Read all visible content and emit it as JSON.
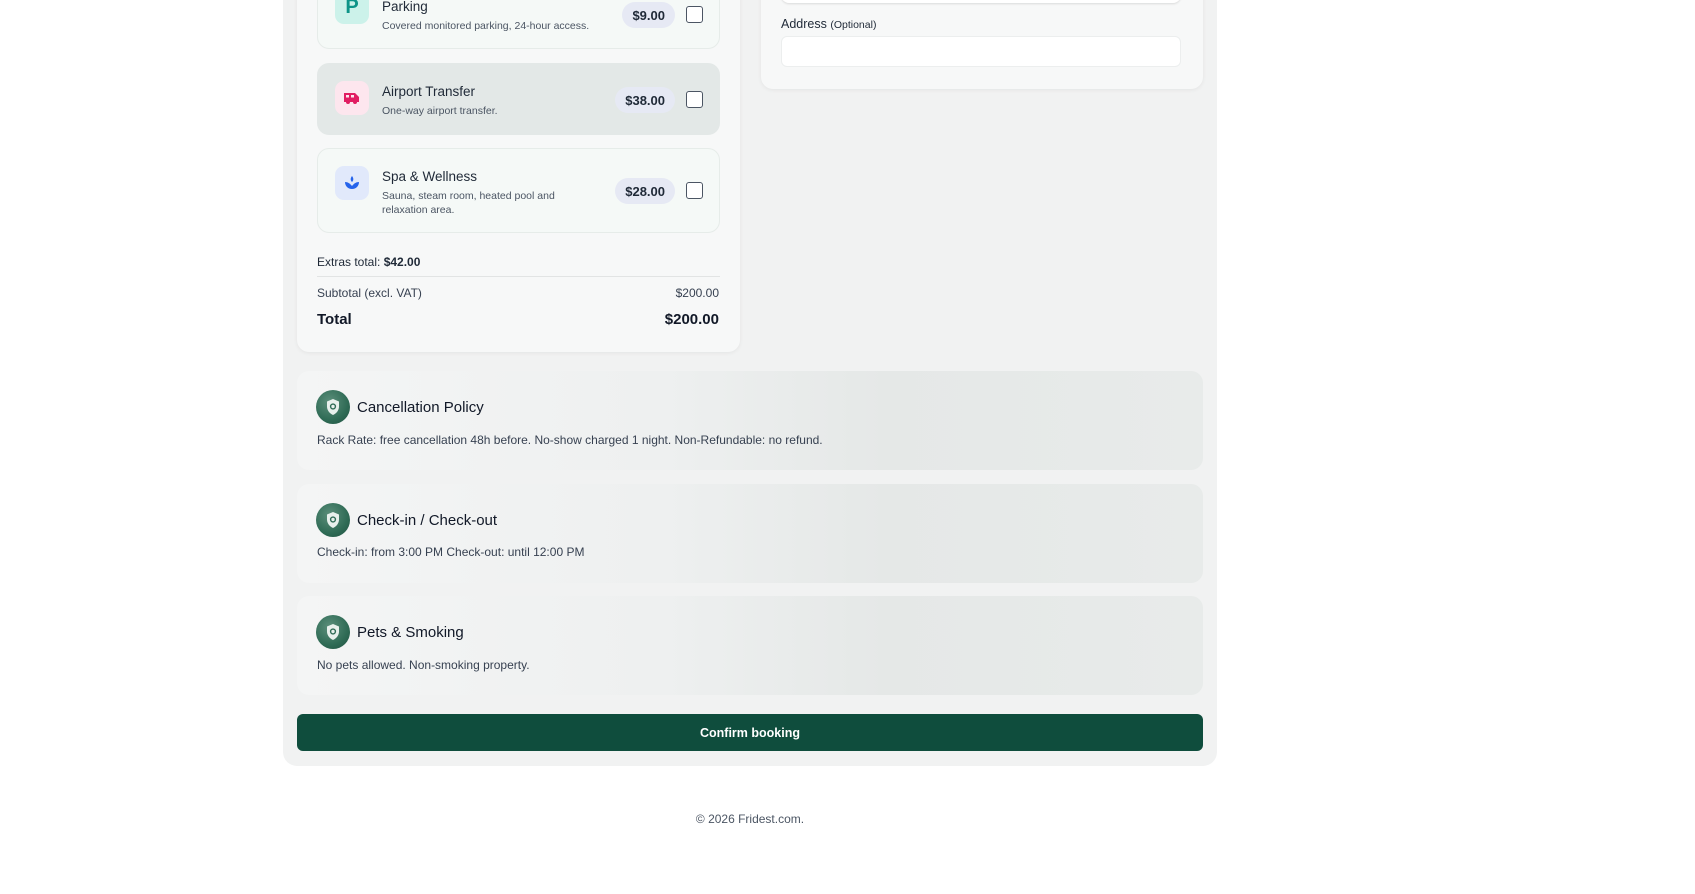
{
  "extras": {
    "items": [
      {
        "title": "Parking",
        "description": "Covered monitored parking, 24-hour access.",
        "price": "$9.00",
        "icon": "parking-icon",
        "icon_color": "#0d9488",
        "icon_bg": "#ccf2ea",
        "checked": false
      },
      {
        "title": "Airport Transfer",
        "description": "One-way airport transfer.",
        "price": "$38.00",
        "icon": "van-icon",
        "icon_color": "#e11d62",
        "icon_bg": "#fde6ee",
        "checked": false
      },
      {
        "title": "Spa & Wellness",
        "description": "Sauna, steam room, heated pool and relaxation area.",
        "price": "$28.00",
        "icon": "spa-icon",
        "icon_color": "#2563eb",
        "icon_bg": "#e1e9fb",
        "checked": false
      }
    ],
    "total_label": "Extras total:",
    "total_value": "$42.00"
  },
  "summary": {
    "subtotal_label": "Subtotal (excl. VAT)",
    "subtotal_value": "$200.00",
    "total_label": "Total",
    "total_value": "$200.00"
  },
  "address": {
    "label": "Address",
    "optional": "(Optional)",
    "value": ""
  },
  "policies": [
    {
      "title": "Cancellation Policy",
      "text": "Rack Rate: free cancellation 48h before. No-show charged 1 night. Non-Refundable: no refund."
    },
    {
      "title": "Check-in / Check-out",
      "text": "Check-in: from 3:00 PM Check-out: until 12:00 PM"
    },
    {
      "title": "Pets & Smoking",
      "text": "No pets allowed. Non-smoking property."
    }
  ],
  "confirm_label": "Confirm booking",
  "footer": "© 2026 Fridest.com.",
  "colors": {
    "primary": "#0f4d3d",
    "price_pill": "#e6e9f4"
  }
}
